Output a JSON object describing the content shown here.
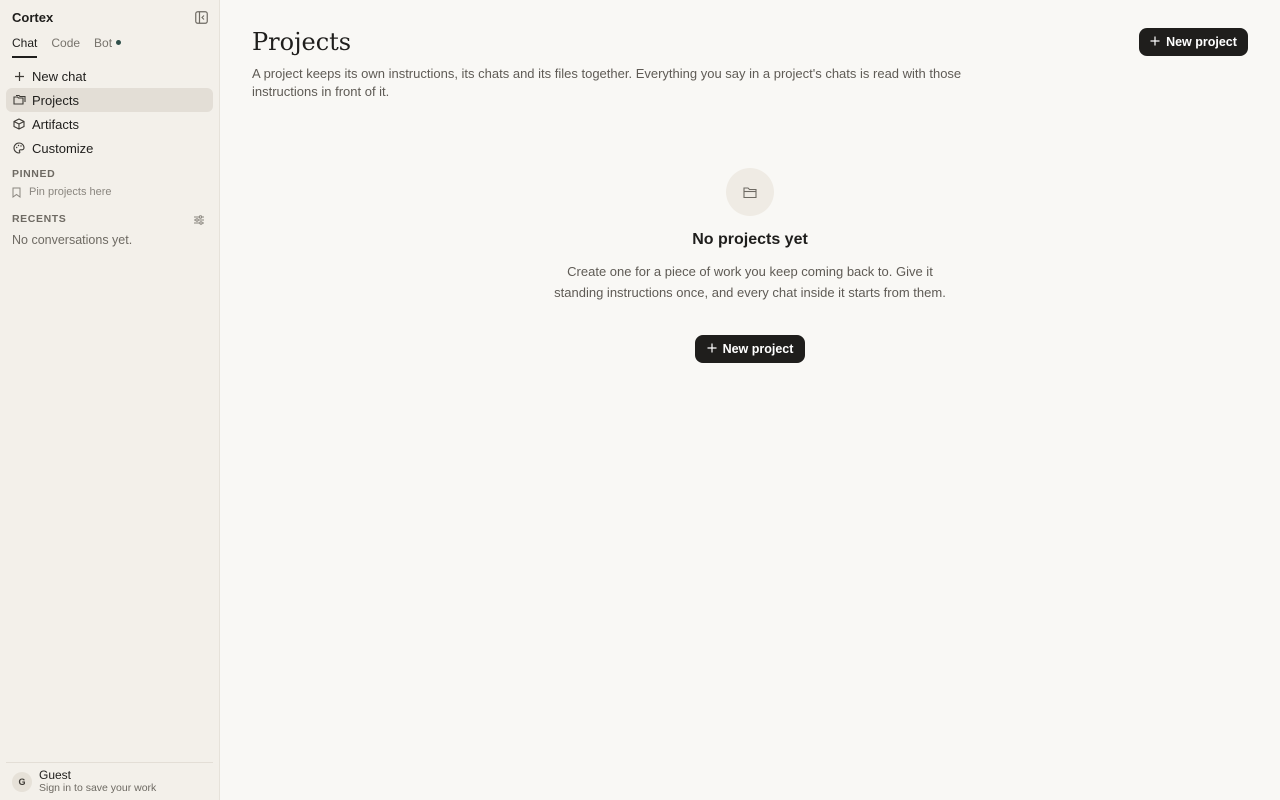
{
  "app": {
    "name": "Cortex"
  },
  "sidebar": {
    "mode_tabs": [
      {
        "label": "Chat",
        "active": true
      },
      {
        "label": "Code",
        "active": false
      },
      {
        "label": "Bot",
        "active": false,
        "has_dot": true
      }
    ],
    "nav_items": [
      {
        "label": "New chat",
        "icon": "plus-icon"
      },
      {
        "label": "Projects",
        "icon": "folders-icon",
        "active": true
      },
      {
        "label": "Artifacts",
        "icon": "cube-icon"
      },
      {
        "label": "Customize",
        "icon": "palette-icon"
      }
    ],
    "pinned_label": "PINNED",
    "pinned_hint": "Pin projects here",
    "recents_label": "RECENTS",
    "recents_empty": "No conversations yet.",
    "account": {
      "initial": "G",
      "name": "Guest",
      "subtitle": "Sign in to save your work"
    }
  },
  "main": {
    "title": "Projects",
    "description": "A project keeps its own instructions, its chats and its files together. Everything you say in a project's chats is read with those instructions in front of it.",
    "new_project_label": "New project",
    "empty_state": {
      "title": "No projects yet",
      "description": "Create one for a piece of work you keep coming back to. Give it standing instructions once, and every chat inside it starts from them.",
      "button_label": "New project"
    }
  },
  "colors": {
    "accent": "#1f1e1c",
    "sidebar_bg": "#f3f0ea",
    "page_bg": "#f9f8f5",
    "bot_dot": "#2f4f4a"
  }
}
